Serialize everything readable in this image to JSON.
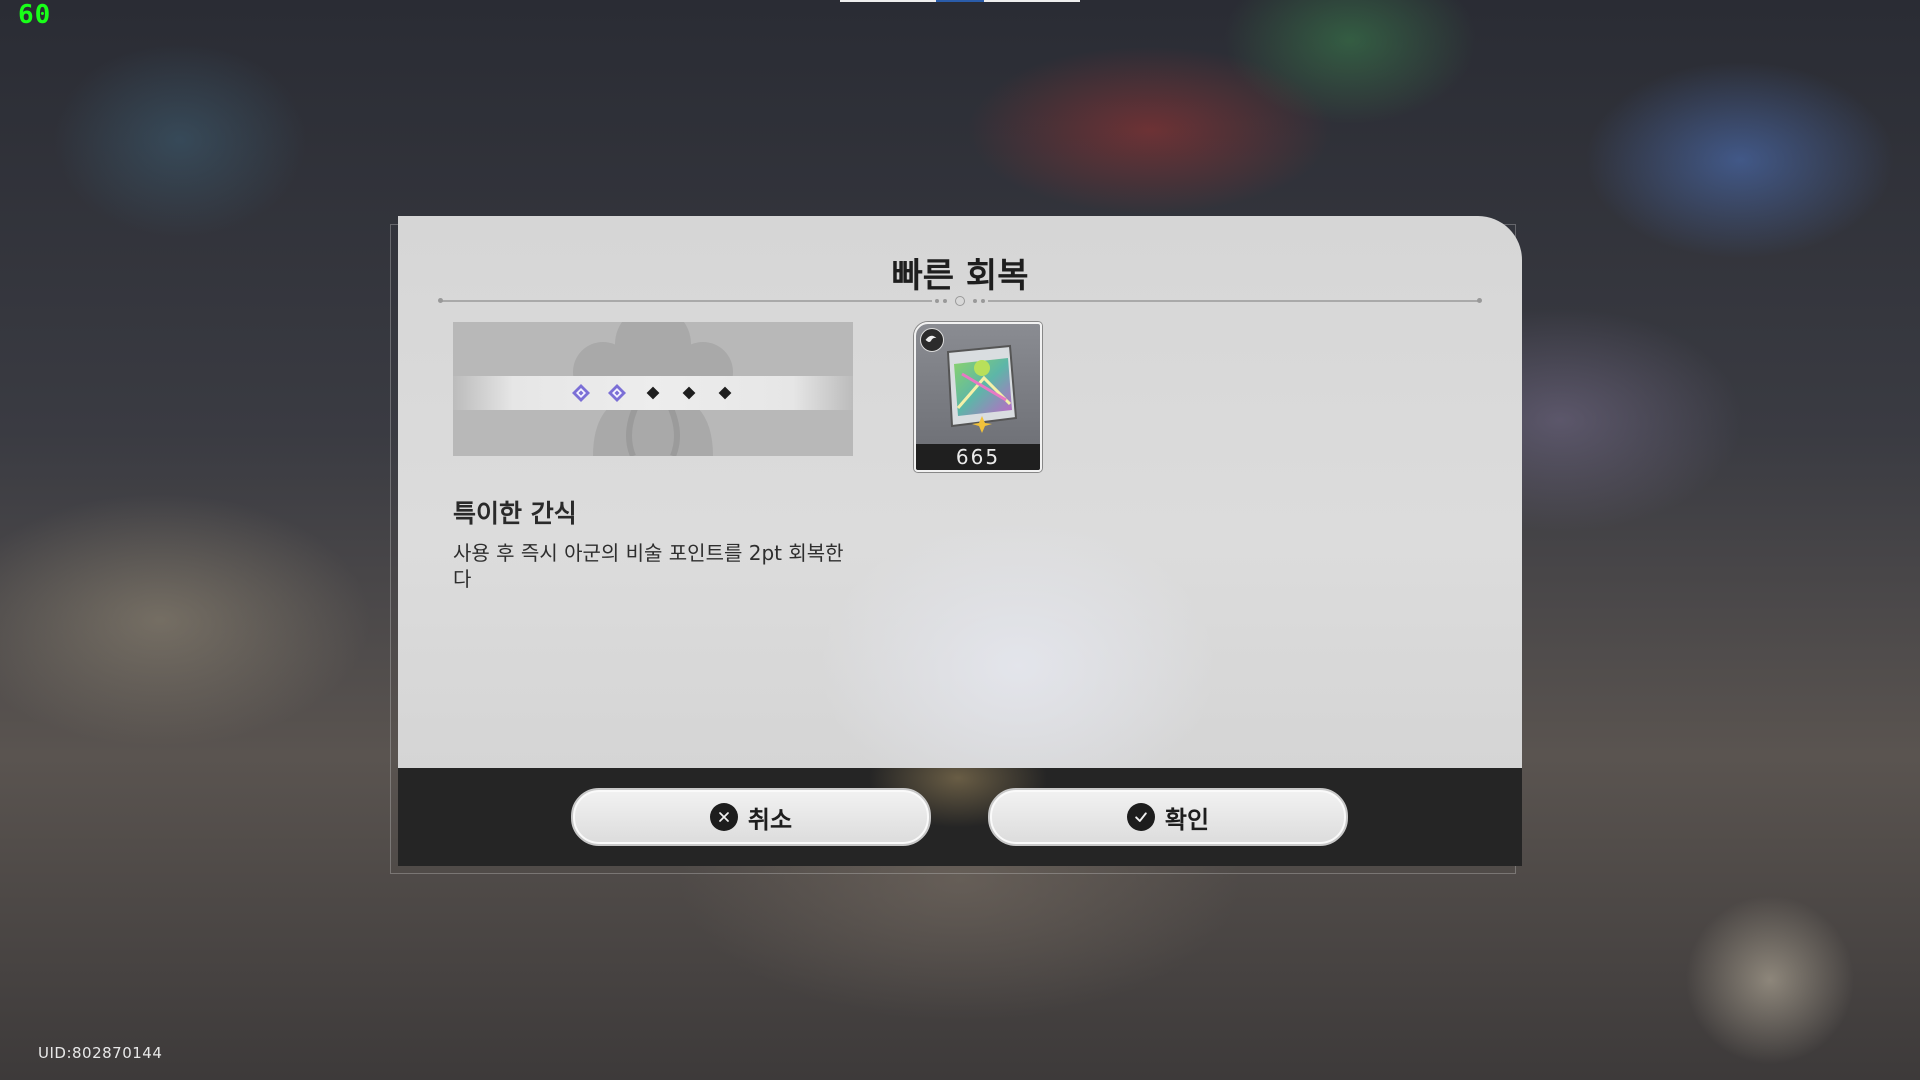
{
  "hud": {
    "fps": "60",
    "uid": "UID:802870144"
  },
  "dialog": {
    "title": "빠른 회복",
    "item": {
      "name": "특이한 간식",
      "description": "사용 후 즉시 아군의 비술 포인트를 2pt 회복한다",
      "count": "665",
      "icon": "snack-pack-icon",
      "badge_icon": "consumable-badge-icon"
    },
    "skill_points": {
      "filled": 2,
      "total": 5,
      "filled_color": "#7b6fd6",
      "empty_color": "#1e1e1e"
    },
    "buttons": {
      "cancel_label": "취소",
      "confirm_label": "확인"
    }
  }
}
